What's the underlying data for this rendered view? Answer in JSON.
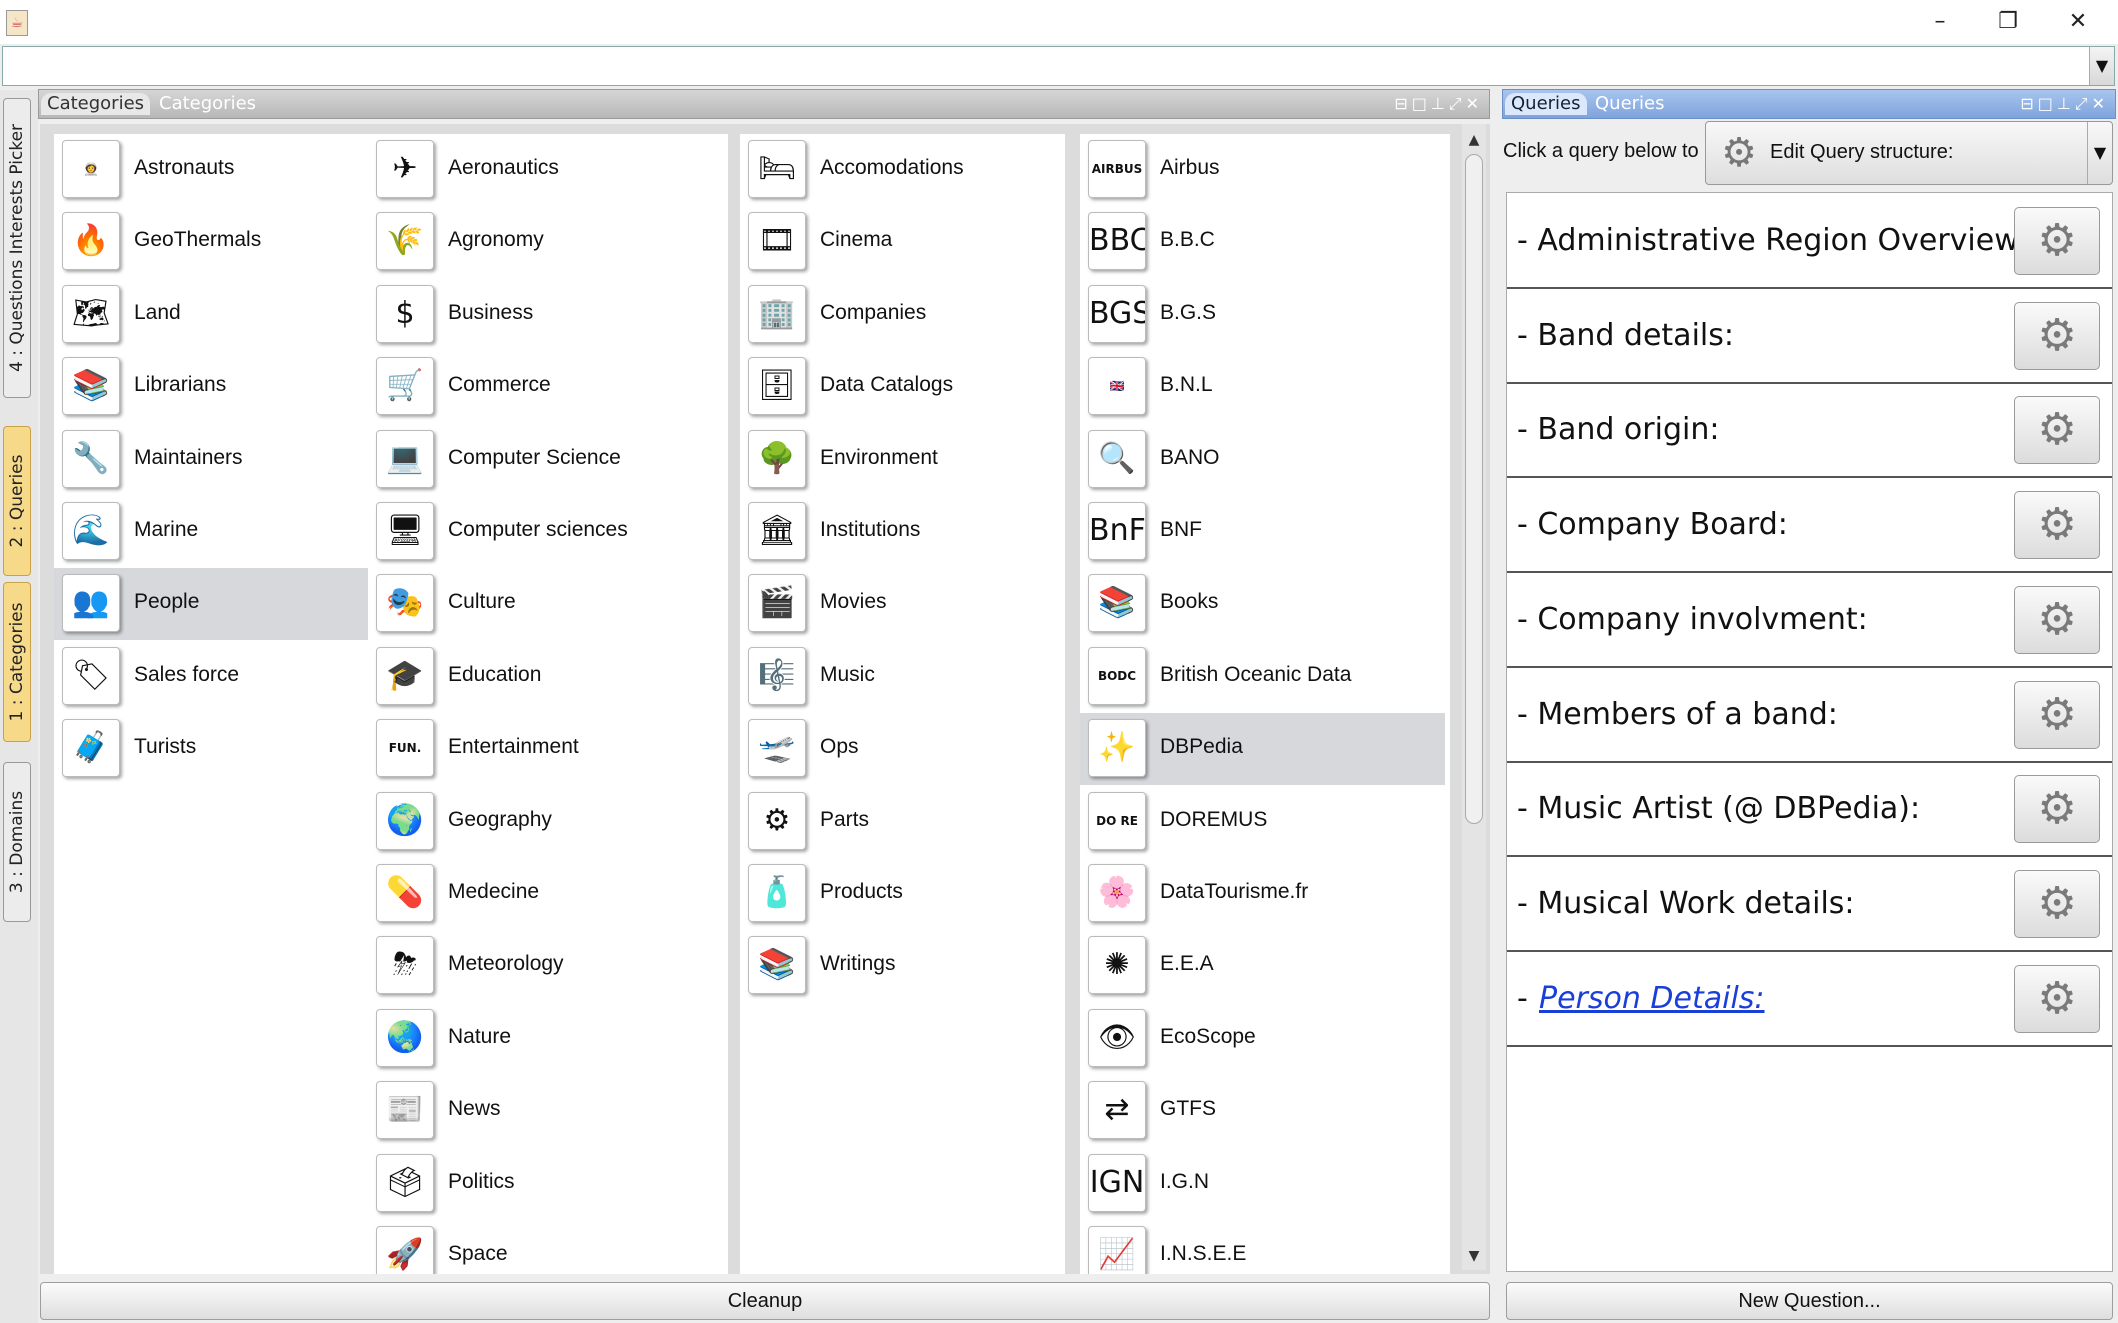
{
  "window": {
    "icon": "java-icon",
    "minimize": "–",
    "restore": "❐",
    "close": "✕"
  },
  "sidebar": {
    "tabs": [
      {
        "label": "4 : Questions Interests Picker",
        "active": false
      },
      {
        "label": "2 : Queries",
        "active": true
      },
      {
        "label": "1 : Categories",
        "active": true
      },
      {
        "label": "3 : Domains",
        "active": false
      }
    ]
  },
  "categories_panel": {
    "tab": "Categories",
    "title": "Categories",
    "columns": [
      [
        {
          "label": "Astronauts",
          "icon": "👩‍🚀"
        },
        {
          "label": "GeoThermals",
          "icon": "🔥"
        },
        {
          "label": "Land",
          "icon": "🗺"
        },
        {
          "label": "Librarians",
          "icon": "📚"
        },
        {
          "label": "Maintainers",
          "icon": "🔧"
        },
        {
          "label": "Marine",
          "icon": "🌊"
        },
        {
          "label": "People",
          "icon": "👥",
          "selected": true
        },
        {
          "label": "Sales force",
          "icon": "🏷"
        },
        {
          "label": "Turists",
          "icon": "🧳"
        }
      ],
      [
        {
          "label": "Aeronautics",
          "icon": "✈"
        },
        {
          "label": "Agronomy",
          "icon": "🌾"
        },
        {
          "label": "Business",
          "icon": "$"
        },
        {
          "label": "Commerce",
          "icon": "🛒"
        },
        {
          "label": "Computer Science",
          "icon": "💻"
        },
        {
          "label": "Computer sciences",
          "icon": "🖥"
        },
        {
          "label": "Culture",
          "icon": "🎭"
        },
        {
          "label": "Education",
          "icon": "🎓"
        },
        {
          "label": "Entertainment",
          "icon": "FUN."
        },
        {
          "label": "Geography",
          "icon": "🌍"
        },
        {
          "label": "Medecine",
          "icon": "💊"
        },
        {
          "label": "Meteorology",
          "icon": "⛈"
        },
        {
          "label": "Nature",
          "icon": "🌏"
        },
        {
          "label": "News",
          "icon": "📰"
        },
        {
          "label": "Politics",
          "icon": "🗳"
        },
        {
          "label": "Space",
          "icon": "🚀"
        }
      ],
      [
        {
          "label": "Accomodations",
          "icon": "🛏"
        },
        {
          "label": "Cinema",
          "icon": "🎞"
        },
        {
          "label": "Companies",
          "icon": "🏢"
        },
        {
          "label": "Data Catalogs",
          "icon": "🗄"
        },
        {
          "label": "Environment",
          "icon": "🌳"
        },
        {
          "label": "Institutions",
          "icon": "🏛"
        },
        {
          "label": "Movies",
          "icon": "🎬"
        },
        {
          "label": "Music",
          "icon": "🎼"
        },
        {
          "label": "Ops",
          "icon": "🛫"
        },
        {
          "label": "Parts",
          "icon": "⚙"
        },
        {
          "label": "Products",
          "icon": "🧴"
        },
        {
          "label": "Writings",
          "icon": "📚"
        }
      ],
      [
        {
          "label": "Airbus",
          "icon": "AIRBUS"
        },
        {
          "label": "B.B.C",
          "icon": "BBC"
        },
        {
          "label": "B.G.S",
          "icon": "BGS"
        },
        {
          "label": "B.N.L",
          "icon": "🇬🇧"
        },
        {
          "label": "BANO",
          "icon": "🔍"
        },
        {
          "label": "BNF",
          "icon": "BnF"
        },
        {
          "label": "Books",
          "icon": "📚"
        },
        {
          "label": "British Oceanic Data",
          "icon": "BODC"
        },
        {
          "label": "DBPedia",
          "icon": "✨",
          "selected": true
        },
        {
          "label": "DOREMUS",
          "icon": "DO RE MUS"
        },
        {
          "label": "DataTourisme.fr",
          "icon": "🌸"
        },
        {
          "label": "E.E.A",
          "icon": "✺"
        },
        {
          "label": "EcoScope",
          "icon": "👁"
        },
        {
          "label": "GTFS",
          "icon": "⇄"
        },
        {
          "label": "I.G.N",
          "icon": "IGN"
        },
        {
          "label": "I.N.S.E.E",
          "icon": "📈"
        }
      ]
    ]
  },
  "queries_panel": {
    "tab": "Queries",
    "title": "Queries",
    "hint": "Click a query below to :",
    "mode": "Edit Query structure:",
    "items": [
      {
        "label": "- Administrative Region Overview:",
        "link": false
      },
      {
        "label": "- Band details:",
        "link": false
      },
      {
        "label": "- Band origin:",
        "link": false
      },
      {
        "label": "- Company Board:",
        "link": false
      },
      {
        "label": "- Company involvment:",
        "link": false
      },
      {
        "label": "- Members of a band:",
        "link": false
      },
      {
        "label": "- Music Artist (@ DBPedia):",
        "link": false
      },
      {
        "label": "- Musical Work details:",
        "link": false
      },
      {
        "label": "Person Details:",
        "link": true
      }
    ]
  },
  "buttons": {
    "cleanup": "Cleanup",
    "new_question": "New Question..."
  }
}
